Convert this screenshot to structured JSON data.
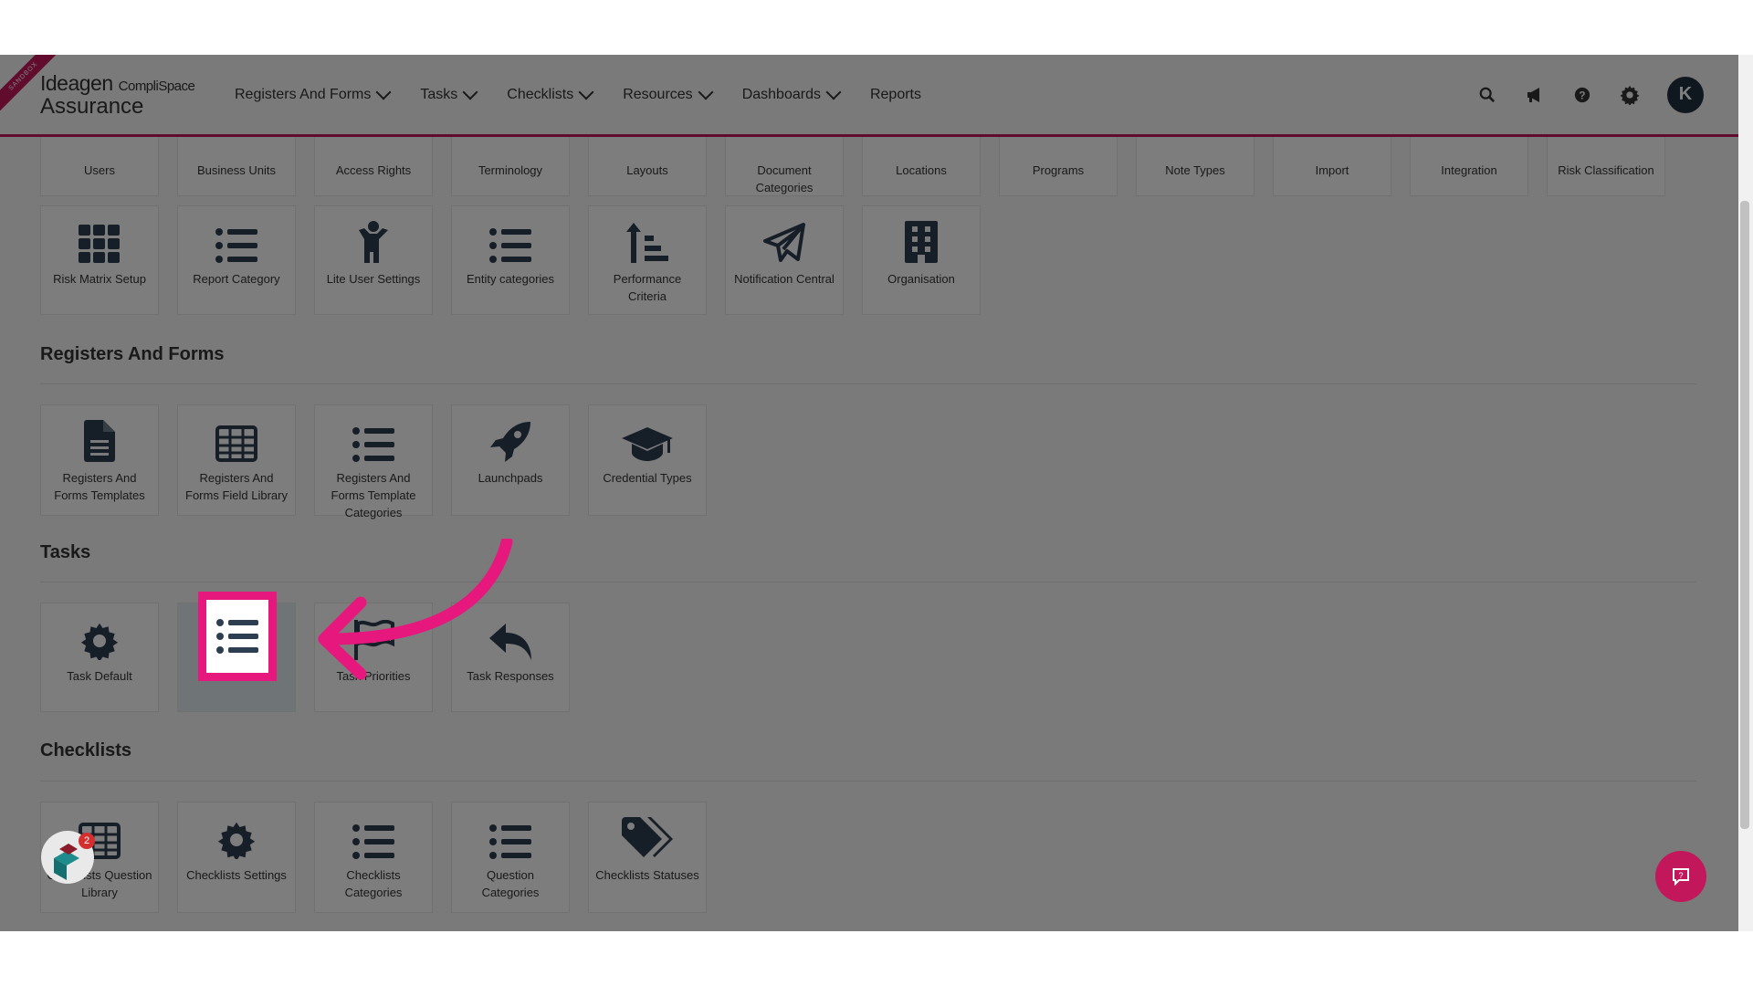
{
  "header": {
    "sandbox_label": "SANDBOX",
    "logo_line1": "Ideagen",
    "logo_sub": "CompliSpace",
    "logo_line2": "Assurance",
    "nav": [
      {
        "label": "Registers And Forms",
        "has_dropdown": true
      },
      {
        "label": "Tasks",
        "has_dropdown": true
      },
      {
        "label": "Checklists",
        "has_dropdown": true
      },
      {
        "label": "Resources",
        "has_dropdown": true
      },
      {
        "label": "Dashboards",
        "has_dropdown": true
      },
      {
        "label": "Reports",
        "has_dropdown": false
      }
    ],
    "icons": [
      "search-icon",
      "megaphone-icon",
      "help-icon",
      "gear-icon"
    ],
    "avatar_letter": "K"
  },
  "top_row": [
    {
      "label": "Users"
    },
    {
      "label": "Business Units"
    },
    {
      "label": "Access Rights"
    },
    {
      "label": "Terminology"
    },
    {
      "label": "Layouts"
    },
    {
      "label": "Document Categories"
    },
    {
      "label": "Locations"
    },
    {
      "label": "Programs"
    },
    {
      "label": "Note Types"
    },
    {
      "label": "Import"
    },
    {
      "label": "Integration"
    },
    {
      "label": "Risk Classification"
    }
  ],
  "second_row": [
    {
      "label": "Risk Matrix Setup",
      "icon": "grid-icon"
    },
    {
      "label": "Report Category",
      "icon": "list-icon"
    },
    {
      "label": "Lite User Settings",
      "icon": "person-icon"
    },
    {
      "label": "Entity categories",
      "icon": "list-icon"
    },
    {
      "label": "Performance Criteria",
      "icon": "sort-icon"
    },
    {
      "label": "Notification Central",
      "icon": "paper-plane-icon"
    },
    {
      "label": "Organisation",
      "icon": "building-icon"
    }
  ],
  "sections": {
    "registers_title": "Registers And Forms",
    "registers": [
      {
        "label": "Registers And Forms Templates",
        "icon": "document-icon"
      },
      {
        "label": "Registers And Forms Field Library",
        "icon": "table-icon"
      },
      {
        "label": "Registers And Forms Template Categories",
        "icon": "list-icon"
      },
      {
        "label": "Launchpads",
        "icon": "rocket-icon"
      },
      {
        "label": "Credential Types",
        "icon": "graduation-cap-icon"
      }
    ],
    "tasks_title": "Tasks",
    "tasks": [
      {
        "label": "Task Default",
        "icon": "gear-icon"
      },
      {
        "label": "",
        "icon": "list-icon"
      },
      {
        "label": "Task Priorities",
        "icon": "flag-icon"
      },
      {
        "label": "Task Responses",
        "icon": "reply-icon"
      }
    ],
    "checklists_title": "Checklists",
    "checklists": [
      {
        "label": "Checklists Question Library",
        "icon": "table-icon"
      },
      {
        "label": "Checklists Settings",
        "icon": "gear-icon"
      },
      {
        "label": "Checklists Categories",
        "icon": "list-icon"
      },
      {
        "label": "Question Categories",
        "icon": "list-icon"
      },
      {
        "label": "Checklists Statuses",
        "icon": "tags-icon"
      }
    ]
  },
  "widget_badge_count": "2",
  "colors": {
    "accent": "#e6187d",
    "brand": "#c2185b",
    "icon": "#2c3e50"
  }
}
